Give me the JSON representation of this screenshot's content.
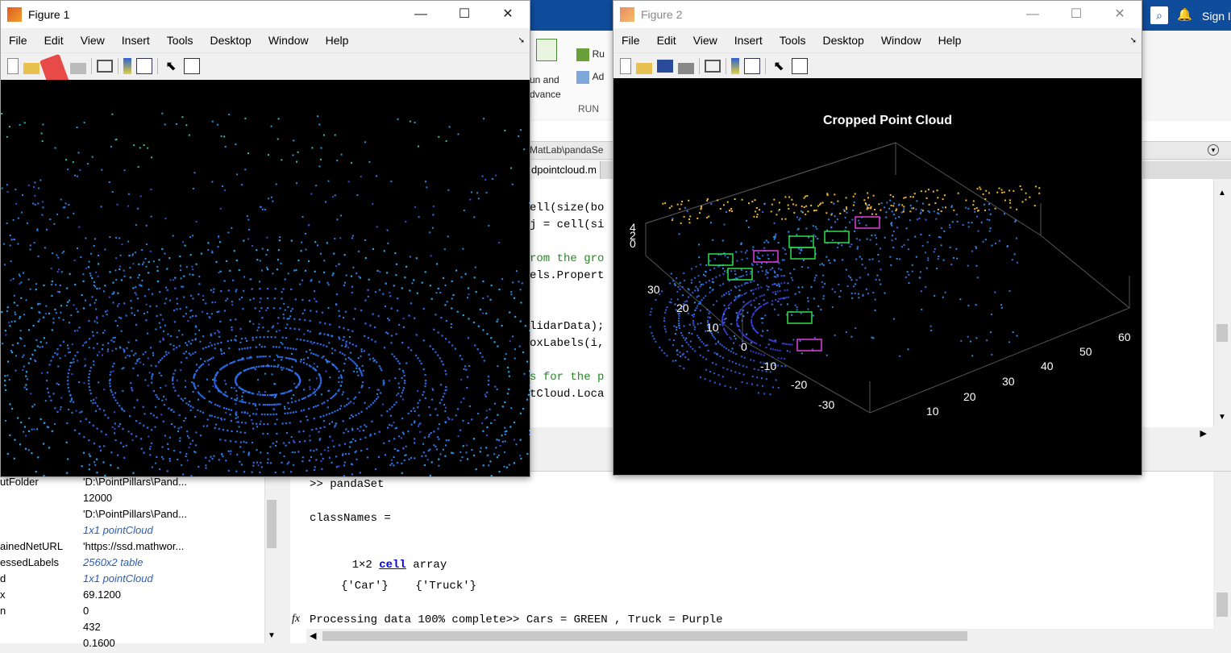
{
  "desktop": {
    "sign_in": "Sign I",
    "ribbon": {
      "run_label": "Ru",
      "adv_label": "Ad",
      "run_and_advance": [
        "un and",
        "dvance"
      ],
      "section_label": "RUN"
    },
    "path": "MatLab\\pandaSe",
    "editor_tab": "dpointcloud.m",
    "code_lines": [
      {
        "text": "ell(size(bo",
        "comment": false
      },
      {
        "text": "j = cell(si",
        "comment": false
      },
      {
        "text": "",
        "comment": false
      },
      {
        "text": "rom the gro",
        "comment": true
      },
      {
        "text": "els.Propert",
        "comment": false
      },
      {
        "text": "",
        "comment": false
      },
      {
        "text": "",
        "comment": false
      },
      {
        "text": "lidarData);",
        "comment": false
      },
      {
        "text": "oxLabels(i,",
        "comment": false
      },
      {
        "text": "",
        "comment": false
      },
      {
        "text": "s for the p",
        "comment": true
      },
      {
        "text": "tCloud.Loca",
        "comment": false
      }
    ]
  },
  "workspace": {
    "rows": [
      {
        "name": "utFolder",
        "value": "'D:\\PointPillars\\Pand...",
        "link": false
      },
      {
        "name": "",
        "value": "12000",
        "link": false
      },
      {
        "name": "",
        "value": "'D:\\PointPillars\\Pand...",
        "link": false
      },
      {
        "name": "",
        "value": "1x1 pointCloud",
        "link": true
      },
      {
        "name": "ainedNetURL",
        "value": "'https://ssd.mathwor...",
        "link": false
      },
      {
        "name": "essedLabels",
        "value": "2560x2 table",
        "link": true
      },
      {
        "name": "d",
        "value": "1x1 pointCloud",
        "link": true
      },
      {
        "name": "x",
        "value": "69.1200",
        "link": false
      },
      {
        "name": "n",
        "value": "0",
        "link": false
      },
      {
        "name": "",
        "value": "432",
        "link": false
      },
      {
        "name": "",
        "value": "0.1600",
        "link": false
      }
    ]
  },
  "command_window": {
    "prompt_line": ">> pandaSet",
    "class_names_label": "classNames =",
    "array_prefix": "1×2 ",
    "array_link": "cell",
    "array_suffix": " array",
    "values_line": "{'Car'}    {'Truck'}",
    "status_line": "Processing data 100% complete>> Cars = GREEN , Truck = Purple",
    "fx_symbol": "fx"
  },
  "figure1": {
    "title": "Figure 1",
    "menus": [
      "File",
      "Edit",
      "View",
      "Insert",
      "Tools",
      "Desktop",
      "Window",
      "Help"
    ]
  },
  "figure2": {
    "title": "Figure 2",
    "menus": [
      "File",
      "Edit",
      "View",
      "Insert",
      "Tools",
      "Desktop",
      "Window",
      "Help"
    ],
    "plot_title": "Cropped Point Cloud",
    "z_ticks": [
      "4",
      "2",
      "0"
    ],
    "y_ticks": [
      "30",
      "20",
      "10",
      "0",
      "-10",
      "-20",
      "-30"
    ],
    "x_ticks": [
      "10",
      "20",
      "30",
      "40",
      "50",
      "60"
    ]
  },
  "window_buttons": {
    "minimize": "—",
    "maximize": "☐",
    "close": "✕"
  }
}
